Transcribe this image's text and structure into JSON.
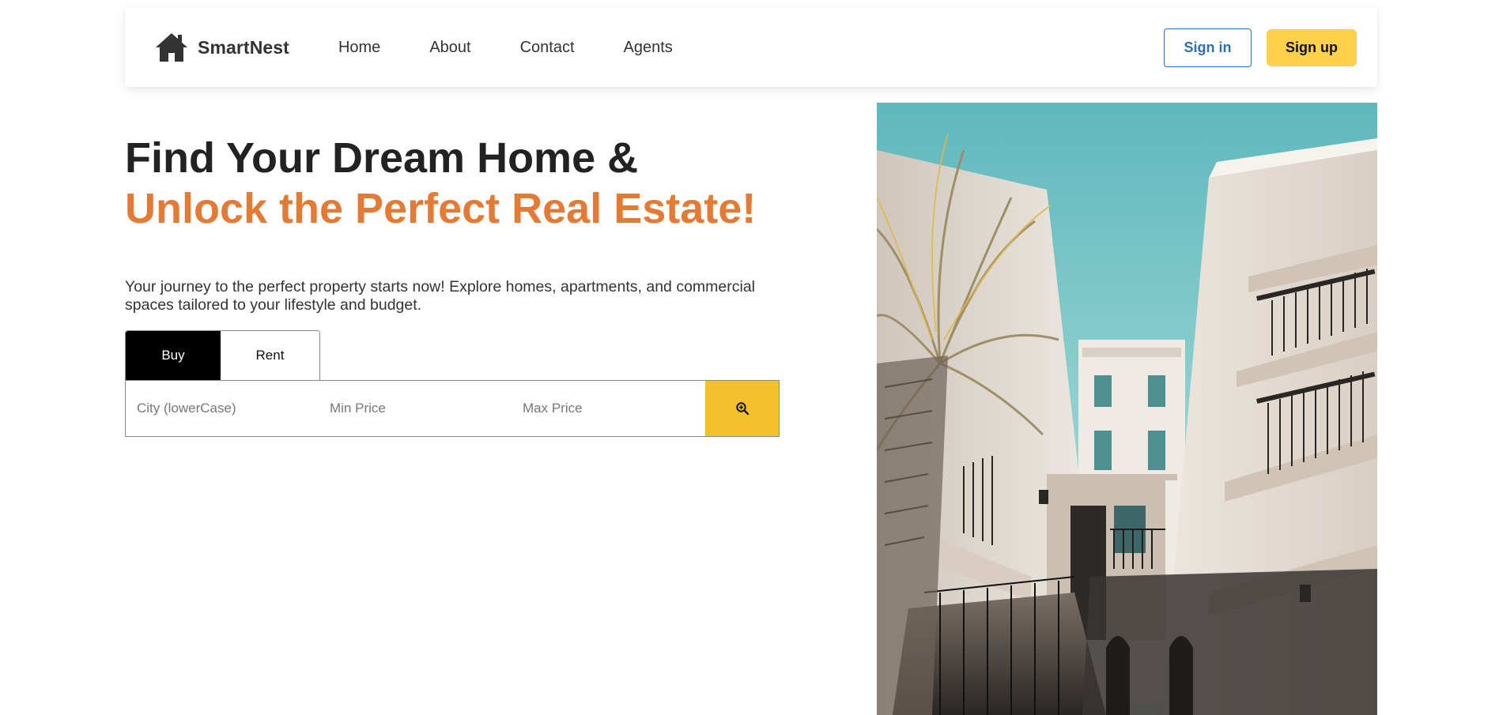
{
  "navbar": {
    "brand_name": "SmartNest",
    "brand_icon": "house-icon",
    "links": [
      "Home",
      "About",
      "Contact",
      "Agents"
    ],
    "signin_label": "Sign in",
    "signup_label": "Sign up"
  },
  "hero": {
    "title_line1": "Find Your Dream Home &",
    "title_line2": "Unlock the Perfect Real Estate!",
    "description": "Your journey to the perfect property starts now! Explore homes, apartments, and commercial spaces tailored to your lifestyle and budget."
  },
  "search": {
    "tabs": [
      "Buy",
      "Rent"
    ],
    "active_tab": "Buy",
    "city_placeholder": "City (lowerCase)",
    "min_price_placeholder": "Min Price",
    "max_price_placeholder": "Max Price",
    "search_icon": "zoom-in-icon"
  },
  "colors": {
    "accent": "#e57a34",
    "signup_bg": "#ffd04a",
    "search_button_bg": "#f3c12b",
    "signin_border": "#2f6eb5",
    "active_tab_bg": "#000000"
  }
}
